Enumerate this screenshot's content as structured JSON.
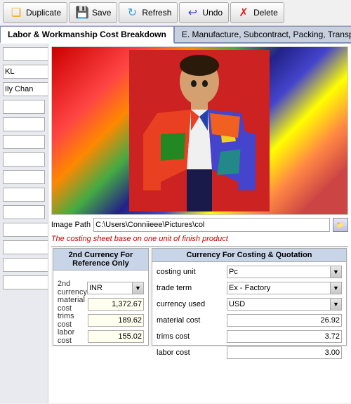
{
  "toolbar": {
    "duplicate_label": "Duplicate",
    "save_label": "Save",
    "refresh_label": "Refresh",
    "undo_label": "Undo",
    "delete_label": "Delete"
  },
  "tabs": [
    {
      "label": "Labor & Workmanship Cost Breakdown",
      "active": true
    },
    {
      "label": "E. Manufacture, Subcontract, Packing, Transport,",
      "active": false
    }
  ],
  "left_panel": {
    "field1_value": "KL",
    "field2_value": "Ily Chan"
  },
  "right_panel": {
    "image_path_label": "Image Path",
    "image_path_value": "C:\\Users\\Conniieee\\Pictures\\col",
    "costing_note": "The costing sheet base on one unit of finish product"
  },
  "second_currency": {
    "header": "2nd Currency For Reference Only",
    "currency_label": "2nd currency",
    "currency_value": "INR",
    "material_cost_label": "material cost",
    "material_cost_value": "1,372.67",
    "trims_cost_label": "trims cost",
    "trims_cost_value": "189.62",
    "labor_cost_label": "labor cost",
    "labor_cost_value": "155.02"
  },
  "costing_currency": {
    "header": "Currency For Costing & Quotation",
    "costing_unit_label": "costing unit",
    "costing_unit_value": "Pc",
    "trade_term_label": "trade term",
    "trade_term_value": "Ex - Factory",
    "currency_used_label": "currency used",
    "currency_used_value": "USD",
    "material_cost_label": "material cost",
    "material_cost_value": "26.92",
    "trims_cost_label": "trims cost",
    "trims_cost_value": "3.72",
    "labor_cost_label": "labor cost",
    "labor_cost_value": "3.00"
  }
}
